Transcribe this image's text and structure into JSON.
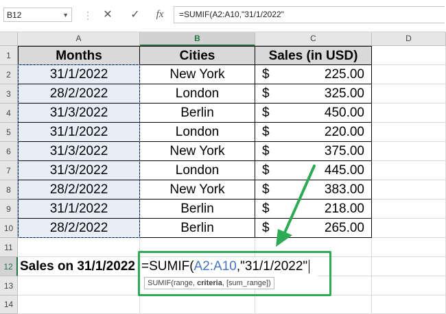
{
  "name_box": "B12",
  "formula_bar": {
    "text": "=SUMIF(A2:A10,\"31/1/2022\"",
    "cancel_icon": "✕",
    "enter_icon": "✓",
    "fx_icon": "fx"
  },
  "columns": [
    "A",
    "B",
    "C",
    "D"
  ],
  "rows": [
    "1",
    "2",
    "3",
    "4",
    "5",
    "6",
    "7",
    "8",
    "9",
    "10",
    "11",
    "12",
    "13",
    "14"
  ],
  "table": {
    "headers": [
      "Months",
      "Cities",
      "Sales (in USD)"
    ],
    "rows": [
      {
        "month": "31/1/2022",
        "city": "New York",
        "currency": "$",
        "amount": "225.00"
      },
      {
        "month": "28/2/2022",
        "city": "London",
        "currency": "$",
        "amount": "325.00"
      },
      {
        "month": "31/3/2022",
        "city": "Berlin",
        "currency": "$",
        "amount": "450.00"
      },
      {
        "month": "31/1/2022",
        "city": "London",
        "currency": "$",
        "amount": "220.00"
      },
      {
        "month": "31/3/2022",
        "city": "New York",
        "currency": "$",
        "amount": "375.00"
      },
      {
        "month": "31/3/2022",
        "city": "London",
        "currency": "$",
        "amount": "445.00"
      },
      {
        "month": "28/2/2022",
        "city": "New York",
        "currency": "$",
        "amount": "383.00"
      },
      {
        "month": "31/1/2022",
        "city": "Berlin",
        "currency": "$",
        "amount": "218.00"
      },
      {
        "month": "28/2/2022",
        "city": "Berlin",
        "currency": "$",
        "amount": "265.00"
      }
    ]
  },
  "label_cell": "Sales on 31/1/2022",
  "edit_cell": {
    "prefix": "=SUMIF(",
    "range_ref": "A2:A10",
    "suffix": ",\"31/1/2022\""
  },
  "tooltip": {
    "func": "SUMIF(range, ",
    "bold_arg": "criteria",
    "rest": ", [sum_range])"
  },
  "colors": {
    "accent_green": "#2eaa55",
    "reference_blue": "#4472c4",
    "header_fill": "#d9d9d9"
  }
}
